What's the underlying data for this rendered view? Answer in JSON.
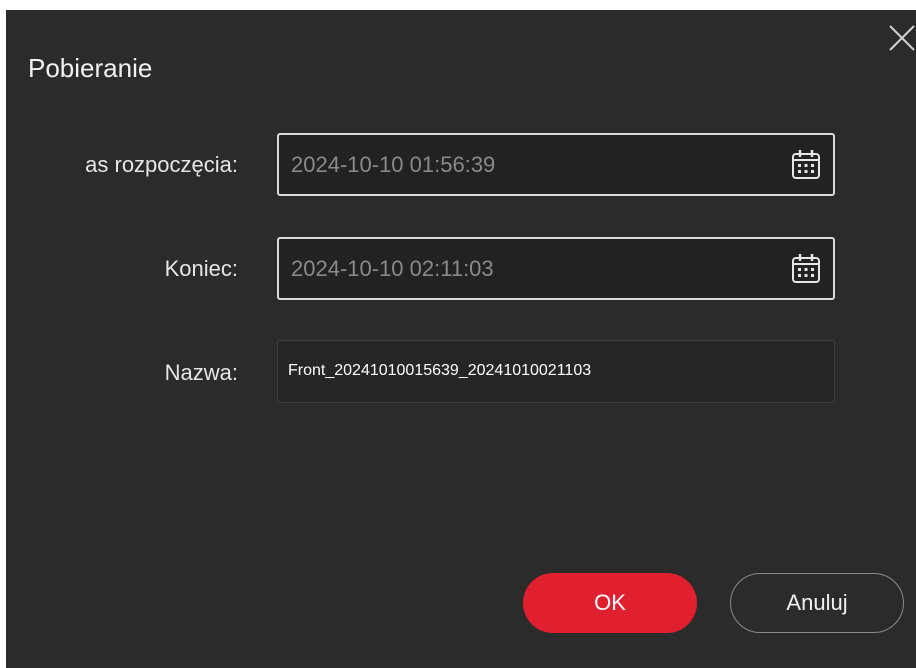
{
  "dialog": {
    "title": "Pobieranie",
    "close_icon": "close-icon"
  },
  "form": {
    "start": {
      "label": "as rozpoczęcia:",
      "value": "2024-10-10 01:56:39",
      "icon": "calendar-icon"
    },
    "end": {
      "label": "Koniec:",
      "value": "2024-10-10 02:11:03",
      "icon": "calendar-icon"
    },
    "name": {
      "label": "Nazwa:",
      "value": "Front_20241010015639_20241010021103"
    }
  },
  "buttons": {
    "ok": "OK",
    "cancel": "Anuluj"
  },
  "colors": {
    "background": "#2b2b2b",
    "accent": "#e0202e",
    "field_border": "#d9d9d9",
    "text": "#f2f2f2",
    "muted_text": "#8a8a8a"
  }
}
